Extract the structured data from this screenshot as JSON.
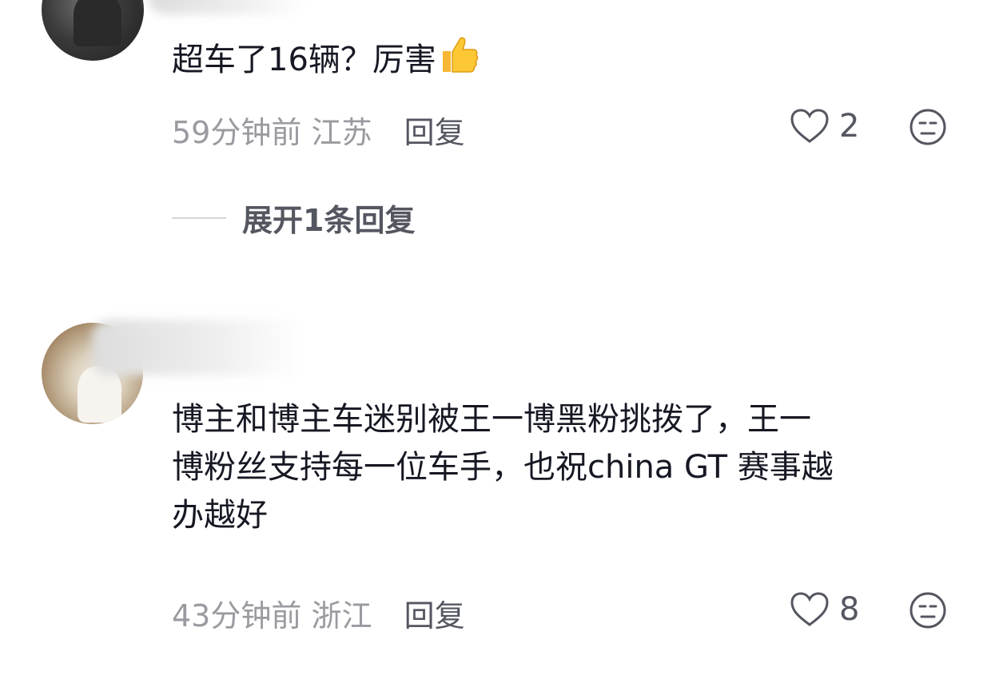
{
  "comments": [
    {
      "text": "超车了16辆？厉害",
      "time": "59分钟前",
      "location": "江苏",
      "reply_label": "回复",
      "likes": "2",
      "expand_label": "展开1条回复",
      "emoji": "thumbs-up"
    },
    {
      "text_lines": [
        "博主和博主车迷别被王一博黑粉挑拨了，王一",
        "博粉丝支持每一位车手，也祝china GT 赛事越",
        "办越好"
      ],
      "time": "43分钟前",
      "location": "浙江",
      "reply_label": "回复",
      "likes": "8"
    }
  ],
  "icons": {
    "like": "heart-outline-icon",
    "dislike": "unamused-face-icon"
  },
  "colors": {
    "text": "#161823",
    "meta": "#9a9aa0",
    "action": "#545660"
  }
}
